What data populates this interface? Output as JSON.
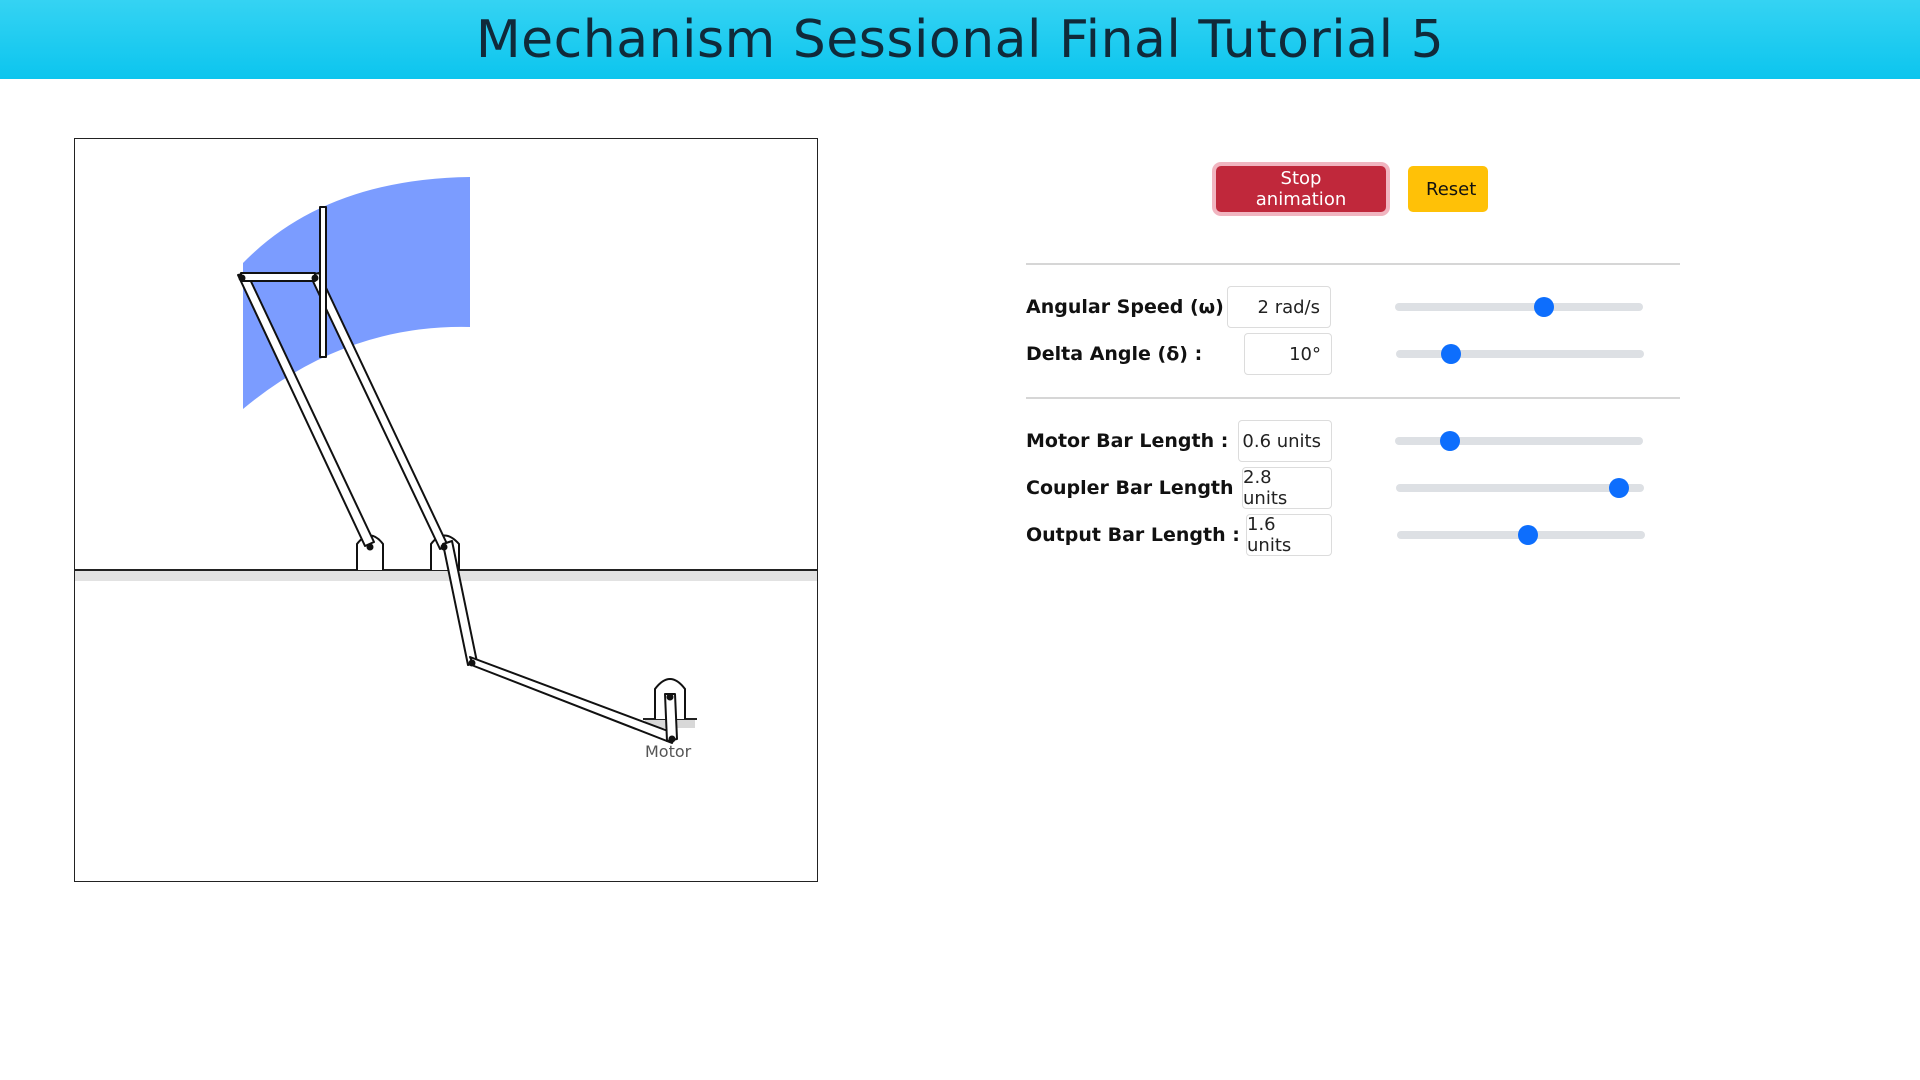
{
  "header": {
    "title": "Mechanism Sessional Final Tutorial 5"
  },
  "canvas": {
    "motor_label": "Motor",
    "trace_color": "#7b9cff"
  },
  "controls": {
    "stop_label": "Stop animation",
    "reset_label": "Reset",
    "sliders": [
      {
        "label": "Angular Speed (ω) :",
        "value": "2 rad/s",
        "fraction": 0.6
      },
      {
        "label": "Delta Angle (δ) :",
        "value": "10°",
        "fraction": 0.22
      },
      {
        "label": "Motor Bar Length :",
        "value": "0.6 units",
        "fraction": 0.22
      },
      {
        "label": "Coupler Bar Length :",
        "value": "2.8 units",
        "fraction": 0.9
      },
      {
        "label": "Output Bar Length :",
        "value": "1.6 units",
        "fraction": 0.53
      }
    ]
  },
  "colors": {
    "stop": "#c0283b",
    "reset": "#ffc107",
    "slider_thumb": "#0d6efd",
    "header": "#1ccbf0"
  }
}
